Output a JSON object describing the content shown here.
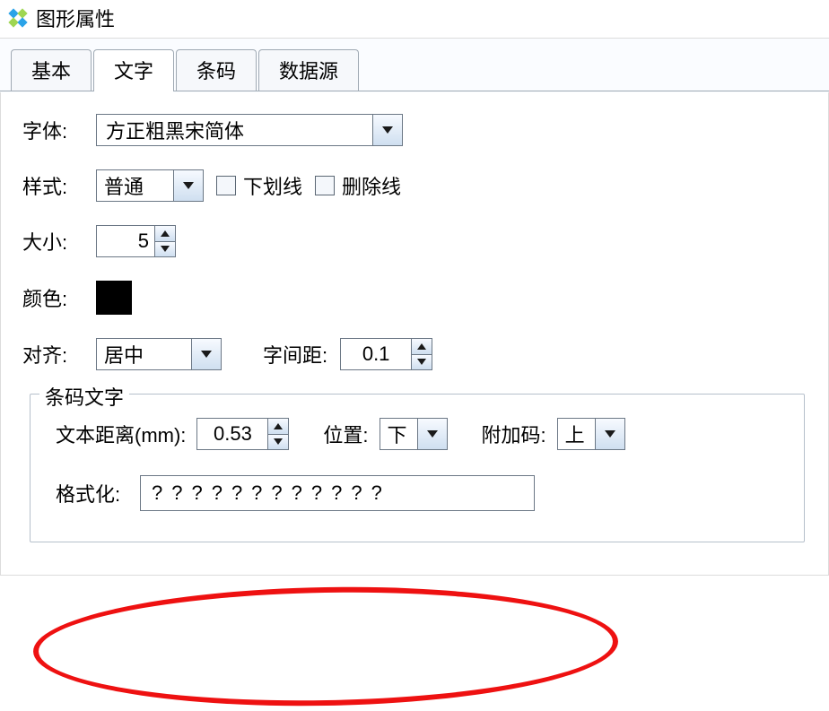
{
  "window": {
    "title": "图形属性"
  },
  "tabs": {
    "basic": "基本",
    "text": "文字",
    "barcode": "条码",
    "datasource": "数据源"
  },
  "labels": {
    "font": "字体:",
    "style": "样式:",
    "underline": "下划线",
    "strikethrough": "删除线",
    "size": "大小:",
    "color": "颜色:",
    "align": "对齐:",
    "charspacing": "字间距:",
    "barcodetext": "条码文字",
    "textdistance": "文本距离(mm):",
    "position": "位置:",
    "addon": "附加码:",
    "format": "格式化:"
  },
  "values": {
    "font": "方正粗黑宋简体",
    "style": "普通",
    "size": "5",
    "align": "居中",
    "charspacing": "0.1",
    "textdistance": "0.53",
    "position": "下",
    "addon": "上",
    "format": "????????????"
  }
}
